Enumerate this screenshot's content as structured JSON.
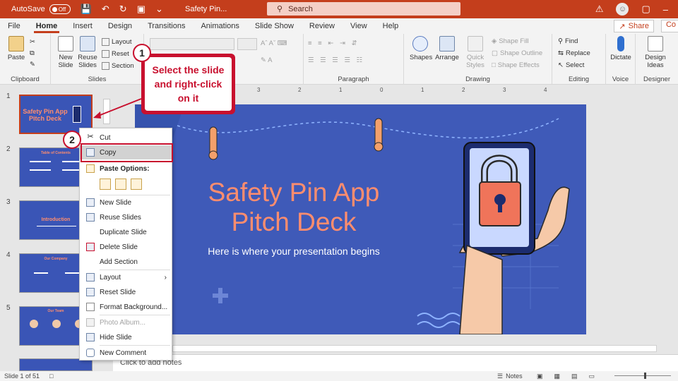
{
  "app": {
    "autosave_label": "AutoSave",
    "autosave_state": "Off",
    "doc_title": "Safety Pin...",
    "search_placeholder": "Search",
    "avatar_initial": "☺"
  },
  "tabs": [
    "File",
    "Home",
    "Insert",
    "Design",
    "Transitions",
    "Animations",
    "Slide Show",
    "Review",
    "View",
    "Help"
  ],
  "active_tab": "Home",
  "share": {
    "label": "Share",
    "comments_label": "Co"
  },
  "ribbon": {
    "clipboard": {
      "label": "Clipboard",
      "paste": "Paste"
    },
    "slides": {
      "label": "Slides",
      "new_slide_1": "New",
      "new_slide_2": "Slide",
      "reuse_1": "Reuse",
      "reuse_2": "Slides",
      "layout": "Layout",
      "reset": "Reset",
      "section": "Section"
    },
    "paragraph": {
      "label": "Paragraph"
    },
    "drawing": {
      "label": "Drawing",
      "shapes": "Shapes",
      "arrange": "Arrange",
      "quick_1": "Quick",
      "quick_2": "Styles",
      "shape_fill": "Shape Fill",
      "shape_outline": "Shape Outline",
      "shape_effects": "Shape Effects"
    },
    "editing": {
      "label": "Editing",
      "find": "Find",
      "replace": "Replace",
      "select": "Select"
    },
    "voice": {
      "label": "Voice",
      "dictate": "Dictate"
    },
    "designer": {
      "label": "Designer",
      "design_1": "Design",
      "design_2": "Ideas"
    }
  },
  "ruler_ticks": [
    "3",
    "2",
    "1",
    "0",
    "1",
    "2",
    "3",
    "4"
  ],
  "thumbnails": [
    {
      "num": "1",
      "title": "Safety Pin App Pitch Deck"
    },
    {
      "num": "2",
      "title": "Table of Contents"
    },
    {
      "num": "3",
      "title": "Introduction"
    },
    {
      "num": "4",
      "title": "Our Company"
    },
    {
      "num": "5",
      "title": "Our Team"
    }
  ],
  "slide": {
    "title_line1": "Safety Pin App",
    "title_line2": "Pitch Deck",
    "subtitle": "Here is where your presentation begins",
    "bg_color": "#3f5ab8",
    "accent_color": "#ff8d6e"
  },
  "context_menu": {
    "cut": "Cut",
    "copy": "Copy",
    "paste_options": "Paste Options:",
    "new_slide": "New Slide",
    "reuse_slides": "Reuse Slides",
    "duplicate_slide": "Duplicate Slide",
    "delete_slide": "Delete Slide",
    "add_section": "Add Section",
    "layout": "Layout",
    "reset_slide": "Reset Slide",
    "format_background": "Format Background...",
    "photo_album": "Photo Album...",
    "hide_slide": "Hide Slide",
    "new_comment": "New Comment"
  },
  "callouts": {
    "step1": "1",
    "step2": "2",
    "instruction": "Select the slide and right-click on it"
  },
  "notes_placeholder": "Click to add notes",
  "status": {
    "slide_of": "Slide 1 of 51",
    "notes": "Notes"
  }
}
